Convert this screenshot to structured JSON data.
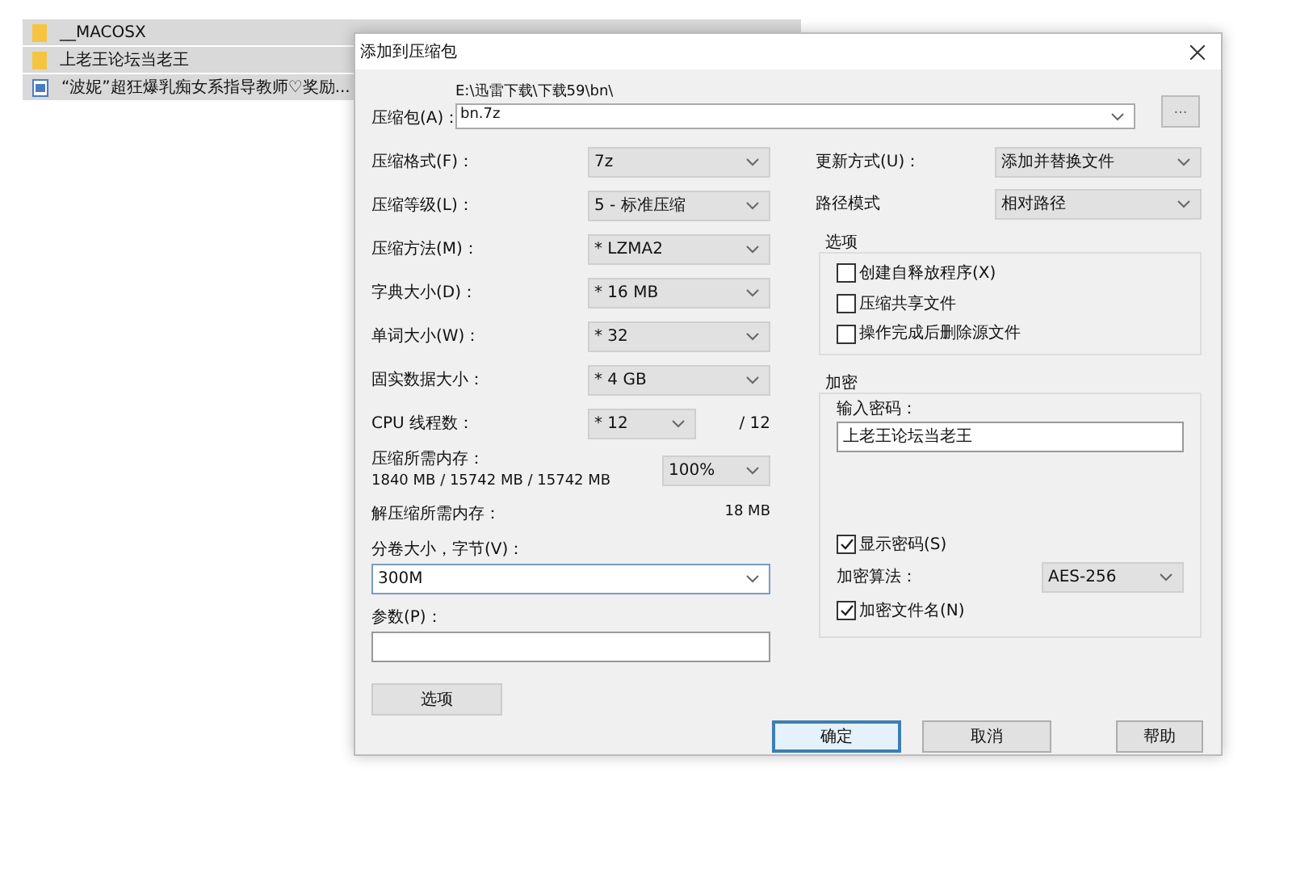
{
  "explorer": {
    "rows": [
      {
        "kind": "folder",
        "name": "__MACOSX",
        "selected": true
      },
      {
        "kind": "folder",
        "name": "上老王论坛当老王",
        "selected": true
      },
      {
        "kind": "file",
        "name": "“波妮”超狂爆乳痴女系指导教师♡奖励...",
        "selected": true
      }
    ]
  },
  "dialog": {
    "title": "添加到压缩包",
    "archive": {
      "label": "压缩包(A)：",
      "path": "E:\\迅雷下载\\下载59\\bn\\",
      "value": "bn.7z",
      "browse": "..."
    },
    "left": [
      {
        "kind": "select",
        "label": "压缩格式(F)：",
        "value": "7z"
      },
      {
        "kind": "select",
        "label": "压缩等级(L)：",
        "value": "5 - 标准压缩"
      },
      {
        "kind": "select",
        "label": "压缩方法(M)：",
        "value": "* LZMA2"
      },
      {
        "kind": "select",
        "label": "字典大小(D)：",
        "value": "* 16 MB"
      },
      {
        "kind": "select",
        "label": "单词大小(W)：",
        "value": "* 32"
      },
      {
        "kind": "select",
        "label": "固实数据大小：",
        "value": "* 4 GB"
      },
      {
        "kind": "cpu",
        "label": "CPU 线程数：",
        "value": "* 12",
        "suffix": "/ 12"
      },
      {
        "kind": "memory",
        "label": "压缩所需内存：",
        "detail": "1840 MB / 15742 MB / 15742 MB",
        "value": "100%"
      },
      {
        "kind": "info",
        "label": "解压缩所需内存：",
        "value": "18 MB"
      }
    ],
    "volume": {
      "label": "分卷大小，字节(V)：",
      "value": "300M"
    },
    "params": {
      "label": "参数(P)："
    },
    "options_button": "选项",
    "update": {
      "label": "更新方式(U)：",
      "value": "添加并替换文件"
    },
    "path_mode": {
      "label": "路径模式",
      "value": "相对路径"
    },
    "options": {
      "title": "选项",
      "items": [
        {
          "label": "创建自释放程序(X)",
          "checked": false
        },
        {
          "label": "压缩共享文件",
          "checked": false
        },
        {
          "label": "操作完成后删除源文件",
          "checked": false
        }
      ]
    },
    "encryption": {
      "title": "加密",
      "password_label": "输入密码：",
      "password": "上老王论坛当老王",
      "show_password": {
        "label": "显示密码(S)",
        "checked": true
      },
      "method": {
        "label": "加密算法：",
        "value": "AES-256"
      },
      "encrypt_names": {
        "label": "加密文件名(N)",
        "checked": true
      }
    },
    "buttons": [
      {
        "label": "确定",
        "selected": true
      },
      {
        "label": "取消",
        "selected": false
      },
      {
        "label": "帮助",
        "selected": false
      }
    ]
  }
}
